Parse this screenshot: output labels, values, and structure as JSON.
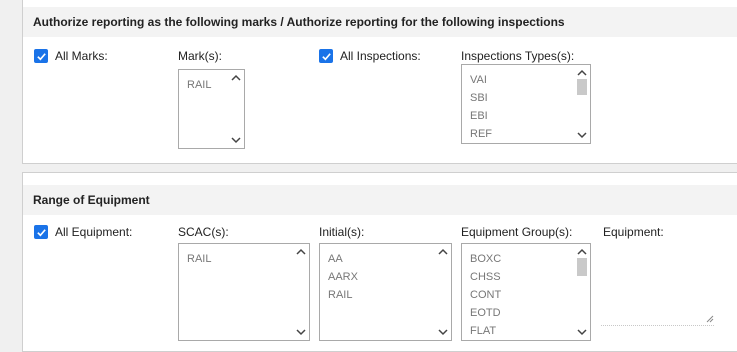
{
  "marks_section": {
    "header": "Authorize reporting as the following marks / Authorize reporting for the following inspections",
    "all_marks_label": "All Marks:",
    "marks_label": "Mark(s):",
    "marks_items": [
      "RAIL"
    ],
    "all_inspections_label": "All Inspections:",
    "inspection_types_label": "Inspections Types(s):",
    "inspection_items": [
      "VAI",
      "SBI",
      "EBI",
      "REF"
    ]
  },
  "equipment_section": {
    "header": "Range of Equipment",
    "all_equipment_label": "All Equipment:",
    "scac_label": "SCAC(s):",
    "scac_items": [
      "RAIL"
    ],
    "initials_label": "Initial(s):",
    "initials_items": [
      "AA",
      "AARX",
      "RAIL"
    ],
    "equipment_group_label": "Equipment Group(s):",
    "equipment_group_items": [
      "BOXC",
      "CHSS",
      "CONT",
      "EOTD",
      "FLAT"
    ],
    "equipment_label": "Equipment:"
  },
  "checkbox_states": {
    "all_marks": true,
    "all_inspections": true,
    "all_equipment": true
  },
  "colors": {
    "accent": "#1a73e8",
    "header_bg": "#f3f3f3",
    "page_bg": "#f0f0f0"
  }
}
